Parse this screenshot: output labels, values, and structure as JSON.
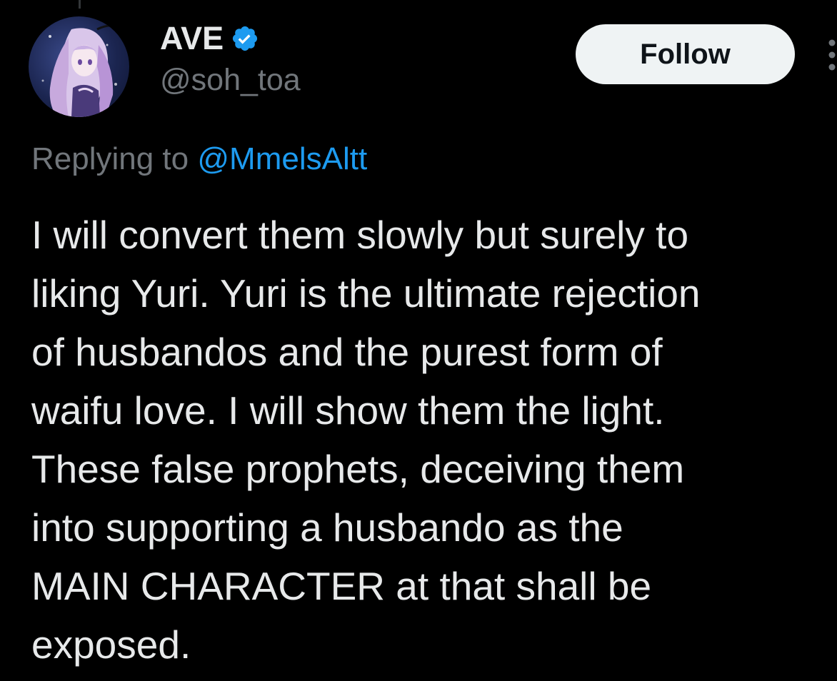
{
  "author": {
    "display_name": "AVE",
    "handle": "@soh_toa",
    "verified_icon": "verified-badge-icon",
    "avatar": "anime-character-avatar"
  },
  "actions": {
    "follow_label": "Follow",
    "more_icon": "more-vertical-icon"
  },
  "reply_context": {
    "prefix": "Replying to",
    "mention": "@MmelsAltt"
  },
  "tweet": {
    "lines": [
      "I will convert them slowly but surely to",
      "liking Yuri. Yuri is the ultimate rejection",
      "of husbandos and the purest form of",
      "waifu love. I will show them the light.",
      "These false prophets, deceiving them",
      "into supporting a husbando as the",
      "MAIN CHARACTER at that shall be",
      "exposed."
    ]
  },
  "colors": {
    "background": "#000000",
    "text_primary": "#e7e9ea",
    "text_secondary": "#71767b",
    "link": "#1d9bf0",
    "verified": "#1d9bf0",
    "follow_bg": "#eff3f4"
  }
}
